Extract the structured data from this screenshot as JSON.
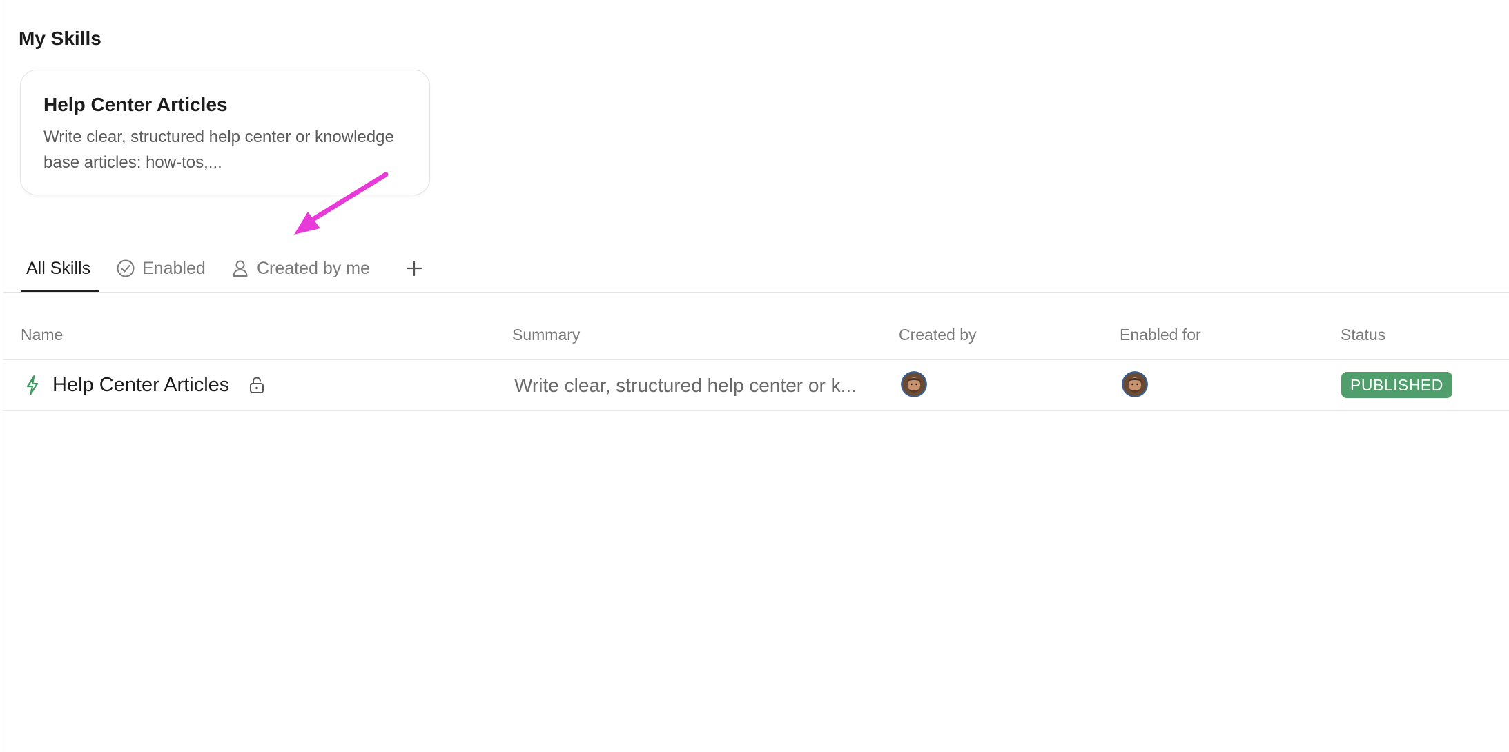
{
  "page": {
    "title": "My Skills"
  },
  "featured_card": {
    "title": "Help Center Articles",
    "description": "Write clear, structured help center or knowledge base articles: how-tos,..."
  },
  "tabs": [
    {
      "label": "All Skills",
      "icon": "none",
      "active": true
    },
    {
      "label": "Enabled",
      "icon": "check-circle-icon",
      "active": false
    },
    {
      "label": "Created by me",
      "icon": "user-icon",
      "active": false
    }
  ],
  "add_tab_icon": "plus-icon",
  "table": {
    "columns": [
      "Name",
      "Summary",
      "Created by",
      "Enabled for",
      "Status"
    ],
    "rows": [
      {
        "name": "Help Center Articles",
        "name_icon": "bolt-icon",
        "locked": true,
        "summary": "Write clear, structured help center or k...",
        "created_by_avatar": "user-avatar",
        "enabled_for_avatar": "user-avatar",
        "status": "PUBLISHED"
      }
    ]
  },
  "colors": {
    "accent_arrow": "#e83ad8",
    "status_published": "#4f9e6b",
    "bolt_icon": "#3f9a5f",
    "active_tab": "#1c1c1c",
    "inactive_tab": "#7a7a7a"
  }
}
